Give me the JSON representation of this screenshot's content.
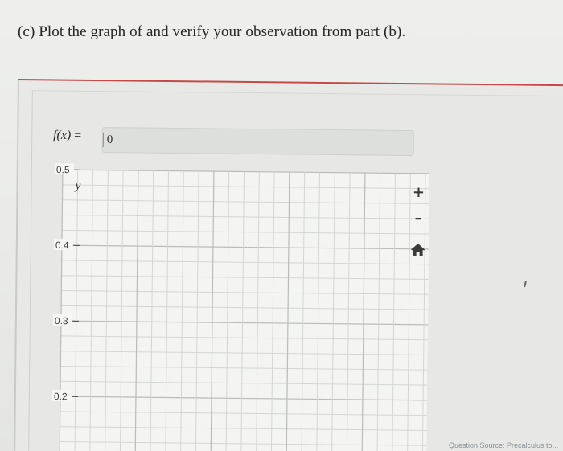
{
  "question": {
    "text": "(c) Plot the graph of and verify your observation from part (b)."
  },
  "function_input": {
    "label_func": "f(x)",
    "label_eq": " = ",
    "value": "0"
  },
  "graph": {
    "axis_label_y": "y",
    "y_ticks": [
      {
        "value": 0.5,
        "label": "0.5"
      },
      {
        "value": 0.4,
        "label": "0.4"
      },
      {
        "value": 0.3,
        "label": "0.3"
      },
      {
        "value": 0.2,
        "label": "0.2"
      }
    ],
    "y_min_visible": 0.13,
    "y_max_visible": 0.5,
    "minor_divisions_per_major": 5,
    "major_columns": 5
  },
  "toolbar": {
    "zoom_in_label": "+",
    "zoom_out_label": "–",
    "home_icon": "home-icon"
  },
  "footer": {
    "text": "Question Source: Precalculus to..."
  },
  "colors": {
    "panel_accent": "#c44a4a",
    "grid_minor": "#d3d6d2",
    "grid_major": "#b9bcb8",
    "graph_bg": "#f4f5f3"
  }
}
